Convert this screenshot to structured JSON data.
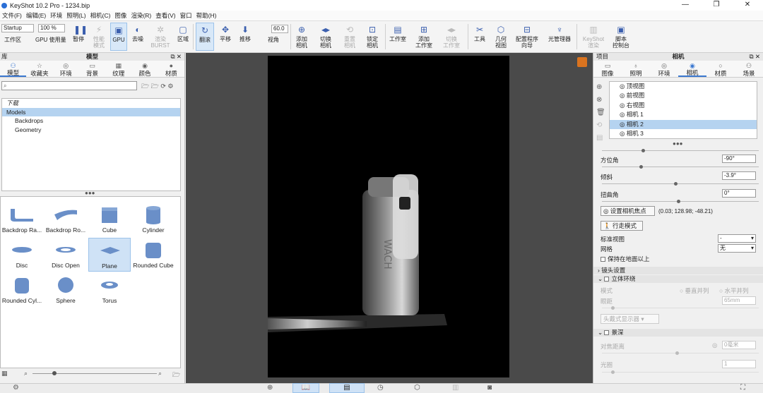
{
  "window": {
    "title": "KeyShot 10.2 Pro  - 1234.bip"
  },
  "menu": [
    "文件(F)",
    "编辑(E)",
    "环境",
    "照明(L)",
    "相机(C)",
    "图像",
    "渲染(R)",
    "查看(V)",
    "窗口",
    "帮助(H)"
  ],
  "toolbar": {
    "startup": "Startup",
    "zoom": "100 %",
    "fov_value": "60.0",
    "buttons": [
      {
        "label": "工作区"
      },
      {
        "label": "GPU"
      },
      {
        "label": "使用量"
      },
      {
        "label": "暂停"
      },
      {
        "label": "性能\n模式"
      },
      {
        "label": "GPU"
      },
      {
        "label": "去噪"
      },
      {
        "label": "渲染\nBURST"
      },
      {
        "label": "区域"
      },
      {
        "label": "翻滚"
      },
      {
        "label": "平移"
      },
      {
        "label": "推移"
      },
      {
        "label": "视角"
      },
      {
        "label": "添加\n相机"
      },
      {
        "label": "切换\n相机"
      },
      {
        "label": "重置\n相机"
      },
      {
        "label": "锁定\n相机"
      },
      {
        "label": "工作室"
      },
      {
        "label": "添加\n工作室"
      },
      {
        "label": "切换\n工作室"
      },
      {
        "label": "工具"
      },
      {
        "label": "几何\n视图"
      },
      {
        "label": "配置程序\n向导"
      },
      {
        "label": "光管理器"
      },
      {
        "label": "KeyShot\n渲染"
      },
      {
        "label": "脚本\n控制台"
      }
    ]
  },
  "left_panel": {
    "title": "模型",
    "corner_label": "库",
    "tabs": [
      "模型",
      "收藏夹",
      "环境",
      "背景",
      "纹理",
      "颜色",
      "材质"
    ],
    "tree": [
      "下载",
      "Models",
      "Backdrops",
      "Geometry"
    ],
    "gallery": [
      "Backdrop Ra...",
      "Backdrop Ro...",
      "Cube",
      "Cylinder",
      "Disc",
      "Disc Open",
      "Plane",
      "Rounded Cube",
      "Rounded Cyl...",
      "Sphere",
      "Torus"
    ],
    "selected_item": "Plane"
  },
  "right_panel": {
    "header_left": "项目",
    "title": "相机",
    "tabs": [
      "图像",
      "照明",
      "环境",
      "相机",
      "材质",
      "场景"
    ],
    "cameras": [
      "顶视图",
      "前视图",
      "右视图",
      "相机 1",
      "相机 2",
      "相机 3"
    ],
    "selected_camera": "相机 2",
    "azimuth": {
      "label": "方位角",
      "value": "-90°"
    },
    "inclination": {
      "label": "倾斜",
      "value": "-3.9°"
    },
    "twist": {
      "label": "扭曲角",
      "value": "0°"
    },
    "set_focus_label": "设置相机焦点",
    "focus_coords": "(0.03; 128.98; -48.21)",
    "walk_mode_label": "行走模式",
    "std_view": {
      "label": "标准视图",
      "value": "-"
    },
    "grid": {
      "label": "网格",
      "value": "无"
    },
    "keep_above_ground": "保持在地面以上",
    "lens_section": "镜头设置",
    "stereo_section": "立体环绕",
    "stereo_mode": "模式",
    "stereo_opt1": "垂直并列",
    "stereo_opt2": "水平并列",
    "stereo_eye": "眼距",
    "stereo_eye_value": "65mm",
    "stereo_device": "头戴式显示器",
    "dof_section": "景深",
    "dof_focus": "对焦距离",
    "dof_focus_value": "0毫米",
    "dof_aperture": "光圈",
    "dof_aperture_value": "1"
  },
  "render": {
    "bottle_text": "WACH"
  }
}
